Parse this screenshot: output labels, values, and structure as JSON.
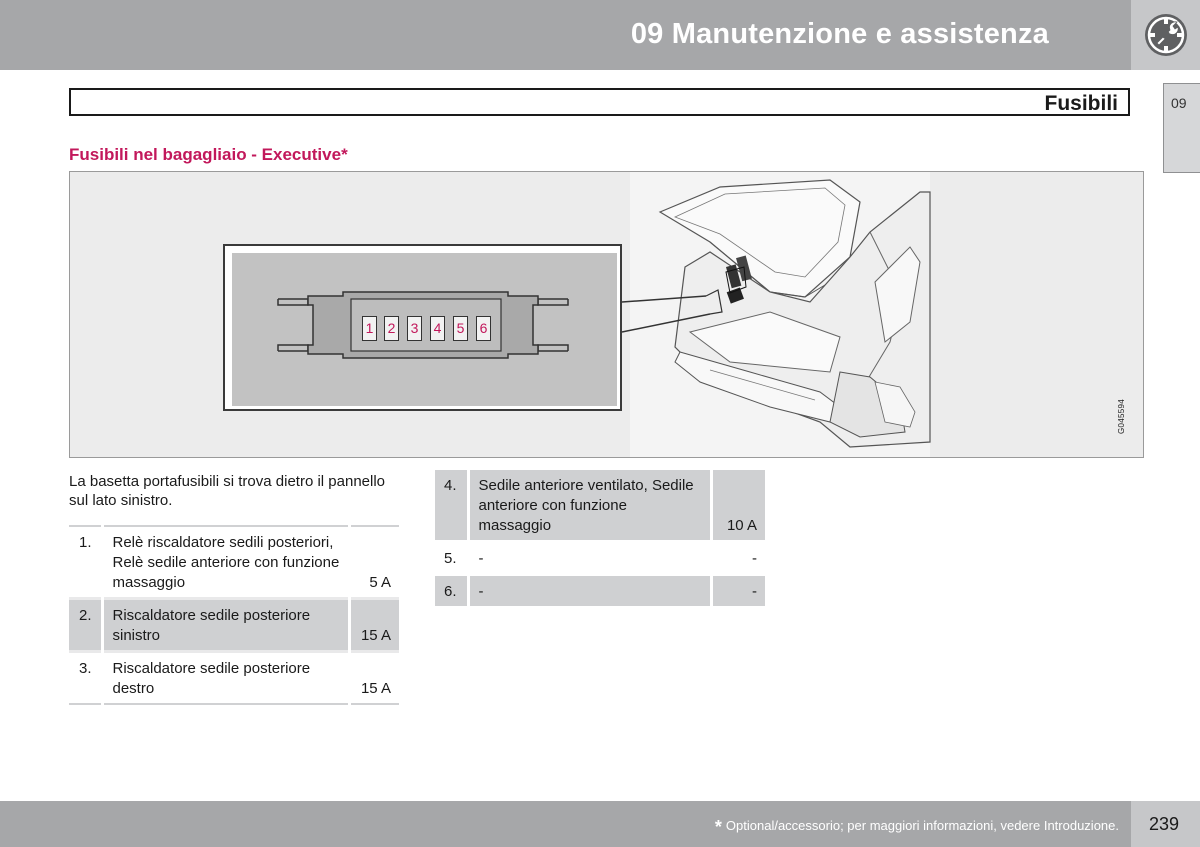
{
  "header": {
    "chapter_title": "09 Manutenzione e assistenza",
    "chapter_icon": "wrench-gear-icon"
  },
  "section": {
    "title": "Fusibili",
    "tab_number": "09"
  },
  "subsection": {
    "title": "Fusibili nel bagagliaio - Executive*"
  },
  "figure": {
    "code": "G045594",
    "fuse_labels": [
      "1",
      "2",
      "3",
      "4",
      "5",
      "6"
    ]
  },
  "intro": "La basetta portafusibili si trova dietro il pannello sul lato sinistro.",
  "table_left": [
    {
      "num": "1.",
      "desc": "Relè riscaldatore sedili posteriori, Relè sedile anteriore con funzione massaggio",
      "amp": "5 A"
    },
    {
      "num": "2.",
      "desc": "Riscaldatore sedile posteriore sinistro",
      "amp": "15 A"
    },
    {
      "num": "3.",
      "desc": "Riscaldatore sedile posteriore destro",
      "amp": "15 A"
    }
  ],
  "table_right": [
    {
      "num": "4.",
      "desc": "Sedile anteriore ventilato, Sedile anteriore con funzione massaggio",
      "amp": "10 A"
    },
    {
      "num": "5.",
      "desc": "-",
      "amp": "-"
    },
    {
      "num": "6.",
      "desc": "-",
      "amp": "-"
    }
  ],
  "footer": {
    "star": "*",
    "note": "Optional/accessorio; per maggiori informazioni, vedere Introduzione.",
    "page_number": "239"
  }
}
